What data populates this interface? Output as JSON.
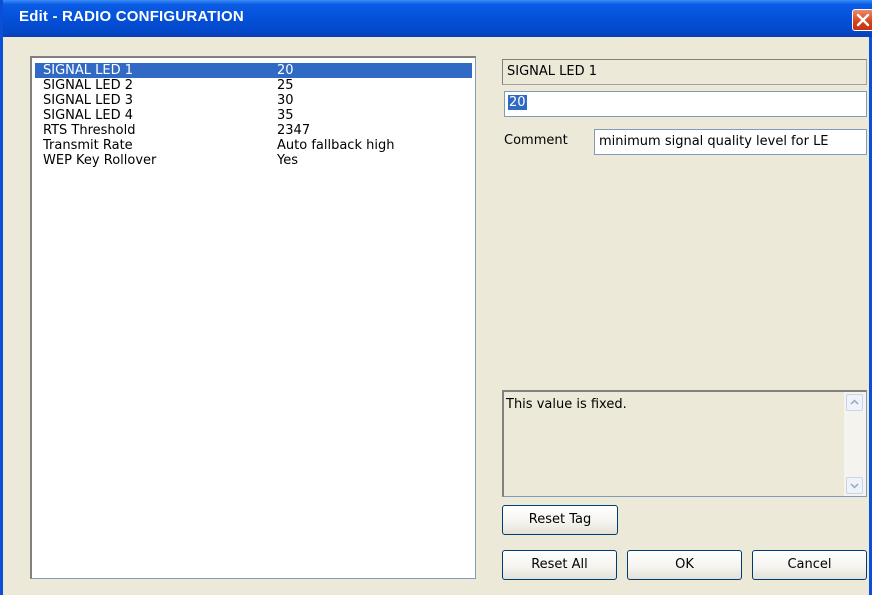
{
  "window": {
    "title": "Edit - RADIO CONFIGURATION"
  },
  "list": {
    "rows": [
      {
        "name": "SIGNAL LED 1",
        "value": "20",
        "selected": true
      },
      {
        "name": "SIGNAL LED 2",
        "value": "25"
      },
      {
        "name": "SIGNAL LED 3",
        "value": "30"
      },
      {
        "name": "SIGNAL LED 4",
        "value": "35"
      },
      {
        "name": "RTS Threshold",
        "value": "2347"
      },
      {
        "name": "Transmit Rate",
        "value": "Auto fallback high"
      },
      {
        "name": "WEP Key Rollover",
        "value": "Yes"
      }
    ]
  },
  "editor": {
    "tag_name": "SIGNAL LED 1",
    "value": "20",
    "comment_label": "Comment",
    "comment": "minimum signal quality level for LE",
    "description": "This value is fixed."
  },
  "buttons": {
    "reset_tag": "Reset Tag",
    "reset_all": "Reset All",
    "ok": "OK",
    "cancel": "Cancel"
  },
  "colors": {
    "title_bar": "#0450d8",
    "selection": "#316ac5",
    "dialog_bg": "#ece9d8",
    "close_button": "#d5421a"
  },
  "icons": {
    "close": "close-icon",
    "scroll_up": "arrow-up-icon",
    "scroll_down": "arrow-down-icon"
  }
}
